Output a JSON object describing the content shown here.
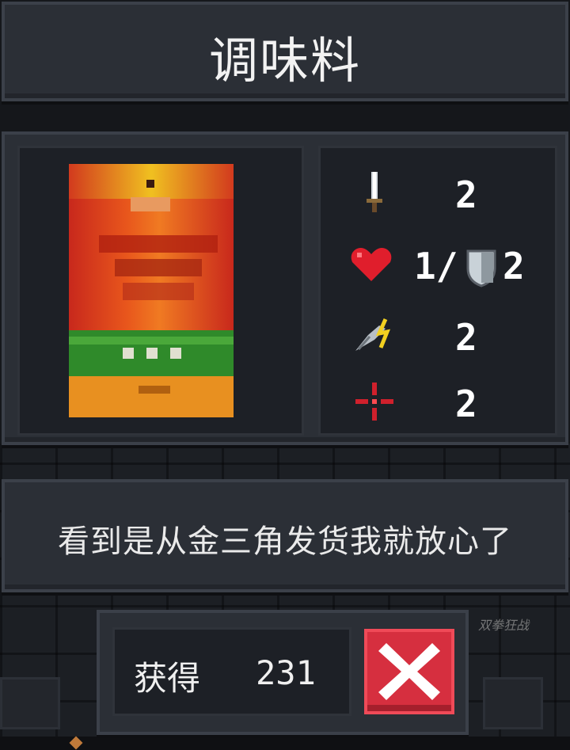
{
  "item": {
    "name": "调味料",
    "description": "看到是从金三角发货我就放心了",
    "icon": "seasoning-can-icon"
  },
  "stats": {
    "damage": {
      "icon": "sword-icon",
      "value": "2"
    },
    "health_armor": {
      "heart_icon": "heart-icon",
      "health": "1/",
      "shield_icon": "shield-icon",
      "armor": "2"
    },
    "speed": {
      "icon": "winged-lightning-icon",
      "value": "2"
    },
    "crit": {
      "icon": "crosshair-icon",
      "value": "2"
    }
  },
  "obtain": {
    "label": "获得",
    "count": "231"
  },
  "close_button": {
    "icon": "close-x-icon",
    "color": "#d62f3f"
  },
  "watermark": "双拳狂战"
}
